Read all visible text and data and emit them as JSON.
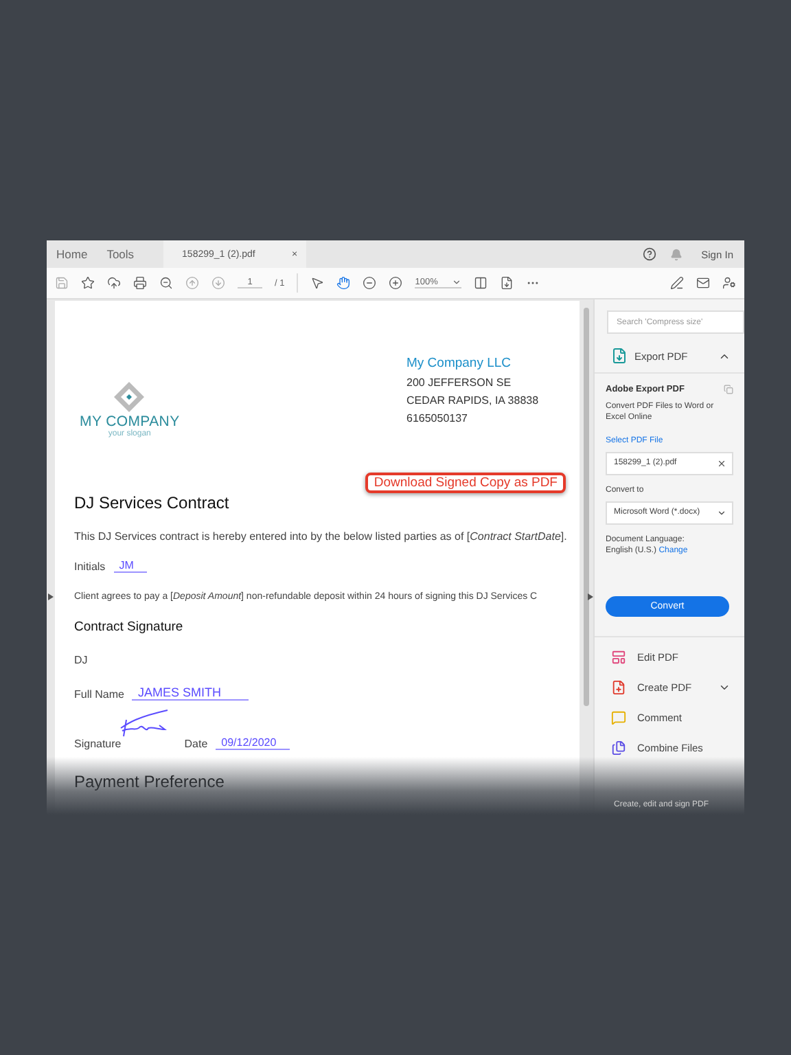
{
  "menu": [
    {
      "label": "Home"
    },
    {
      "label": "Tools"
    }
  ],
  "file_tab": {
    "label": "158299_1 (2).pdf",
    "close": "×"
  },
  "account": {
    "sign_in": "Sign In"
  },
  "toolbar": {
    "page": "1",
    "page_total": "/ 1",
    "zoom": "100%",
    "hand_tool_selected": true
  },
  "document": {
    "logo": {
      "name": "MY COMPANY",
      "slogan": "your slogan"
    },
    "company": {
      "name": "My Company LLC",
      "lines": [
        "200 JEFFERSON SE",
        "CEDAR RAPIDS, IA 38838",
        "6165050137"
      ]
    },
    "download_button": "Download Signed Copy as PDF",
    "title": "DJ Services Contract",
    "intro": "This DJ Services contract is hereby entered into by the below listed parties as of  [*Contract StartDate*].",
    "initials": {
      "label": "Initials",
      "value": "JM"
    },
    "deposit": "Client agrees to pay a [*Deposit Amount*] non-refundable deposit within 24 hours of signing this DJ Services C",
    "signature_heading": "Contract Signature",
    "party": "DJ",
    "full_name": {
      "label": "Full Name",
      "value": "JAMES SMITH"
    },
    "signature_label": "Signature",
    "date": {
      "label": "Date",
      "value": "09/12/2020"
    },
    "next_heading": "Payment Preference"
  },
  "panel": {
    "search_placeholder": "Search 'Compress size'",
    "export": {
      "title": "Export PDF",
      "expanded": true,
      "heading": "Adobe Export PDF",
      "description": "Convert PDF Files to Word or Excel Online",
      "select_link": "Select PDF File",
      "file": "158299_1 (2).pdf",
      "convert_label": "Convert to",
      "format": "Microsoft Word (*.docx)",
      "language_label": "Document Language:",
      "language": "English (U.S.)",
      "change_link": "Change",
      "convert_button": "Convert"
    },
    "tools": [
      {
        "label": "Edit PDF",
        "has_menu": false
      },
      {
        "label": "Create PDF",
        "has_menu": true
      },
      {
        "label": "Comment",
        "has_menu": false
      },
      {
        "label": "Combine Files",
        "has_menu": false
      }
    ],
    "footer": "Create, edit and sign PDF"
  }
}
